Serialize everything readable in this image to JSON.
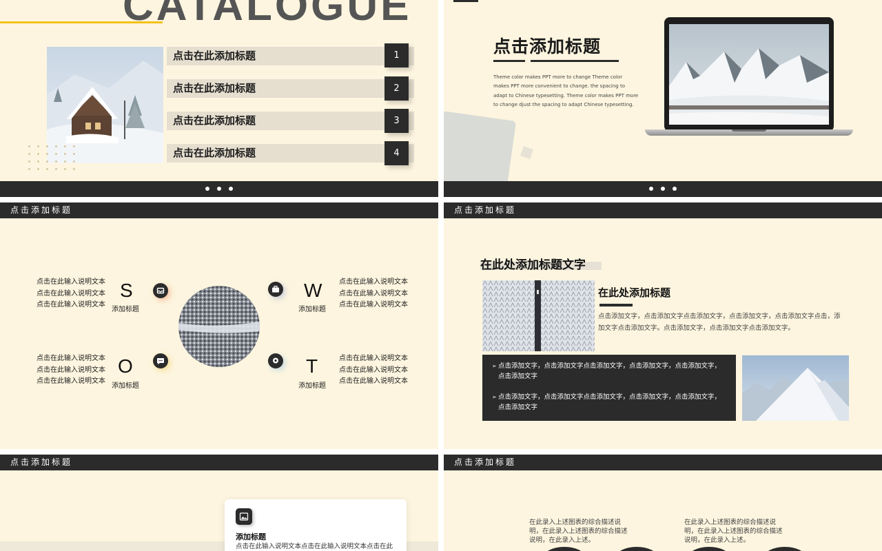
{
  "slide1": {
    "heading": "CATALOGUE",
    "items": [
      {
        "label": "点击在此添加标题",
        "num": "1"
      },
      {
        "label": "点击在此添加标题",
        "num": "2"
      },
      {
        "label": "点击在此添加标题",
        "num": "3"
      },
      {
        "label": "点击在此添加标题",
        "num": "4"
      }
    ]
  },
  "slide2": {
    "title": "点击添加标题",
    "body": "Theme color makes PPT more to change Theme color makes PPT more convenient to change. the spacing to adapt to Chinese typesetting. Theme color makes PPT more to change djust the spacing to adapt Chinese typesetting."
  },
  "slide3": {
    "header": "点击添加标题",
    "s": {
      "letter": "S",
      "label": "添加标题",
      "lines": [
        "点击在此输入说明文本",
        "点击在此输入说明文本",
        "点击在此输入说明文本"
      ]
    },
    "w": {
      "letter": "W",
      "label": "添加标题",
      "lines": [
        "点击在此输入说明文本",
        "点击在此输入说明文本",
        "点击在此输入说明文本"
      ]
    },
    "o": {
      "letter": "O",
      "label": "添加标题",
      "lines": [
        "点击在此输入说明文本",
        "点击在此输入说明文本",
        "点击在此输入说明文本"
      ]
    },
    "t": {
      "letter": "T",
      "label": "添加标题",
      "lines": [
        "点击在此输入说明文本",
        "点击在此输入说明文本",
        "点击在此输入说明文本"
      ]
    },
    "icons": {
      "s": "inbox-icon",
      "w": "briefcase-icon",
      "o": "chat-icon",
      "t": "location-pin-icon"
    }
  },
  "slide4": {
    "header": "点击添加标题",
    "main_title": "在此处添加标题文字",
    "sub_title": "在此处添加标题",
    "body": "点击添加文字，点击添加文字点击添加文字，点击添加文字，点击添加文字点击，添加文字点击添加文字。点击添加文字，点击添加文字点击添加文字。",
    "bullets": [
      "点击添加文字，点击添加文字点击添加文字，点击添加文字，点击添加文字，点击添加文字",
      "点击添加文字，点击添加文字点击添加文字，点击添加文字，点击添加文字，点击添加文字"
    ]
  },
  "slide5": {
    "header": "点击添加标题",
    "card_title": "添加标题",
    "card_body": "点击在此输入说明文本点击在此输入说明文本点击在此",
    "card_icon": "image-icon"
  },
  "slide6": {
    "header": "点击添加标题",
    "left_text": "在此录入上述图表的综合描述说明，在此录入上述图表的综合描述说明，在此录入上述。",
    "right_text": "在此录入上述图表的综合描述说明，在此录入上述图表的综合描述说明，在此录入上述。"
  }
}
